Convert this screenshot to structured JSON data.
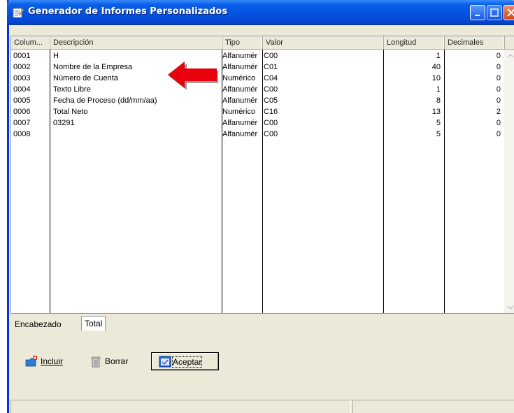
{
  "window": {
    "title": "Generador de Informes Personalizados"
  },
  "grid": {
    "headers": [
      "Colum...",
      "Descripción",
      "Tipo",
      "Valor",
      "Longitud",
      "Decimales"
    ],
    "rows": [
      {
        "col": "0001",
        "desc": "H",
        "tipo": "Alfanumér",
        "valor": "C00",
        "longitud": "1",
        "decimales": "0"
      },
      {
        "col": "0002",
        "desc": "Nombre de la Empresa",
        "tipo": "Alfanumér",
        "valor": "C01",
        "longitud": "40",
        "decimales": "0"
      },
      {
        "col": "0003",
        "desc": "Número de Cuenta",
        "tipo": "Numérico",
        "valor": "C04",
        "longitud": "10",
        "decimales": "0"
      },
      {
        "col": "0004",
        "desc": "Texto Libre",
        "tipo": "Alfanumér",
        "valor": "C00",
        "longitud": "1",
        "decimales": "0"
      },
      {
        "col": "0005",
        "desc": "Fecha de Proceso (dd/mm/aa)",
        "tipo": "Alfanumér",
        "valor": "C05",
        "longitud": "8",
        "decimales": "0"
      },
      {
        "col": "0006",
        "desc": "Total Neto",
        "tipo": "Numérico",
        "valor": "C16",
        "longitud": "13",
        "decimales": "2"
      },
      {
        "col": "0007",
        "desc": "03291",
        "tipo": "Alfanumér",
        "valor": "C00",
        "longitud": "5",
        "decimales": "0"
      },
      {
        "col": "0008",
        "desc": "",
        "tipo": "Alfanumér",
        "valor": "C00",
        "longitud": "5",
        "decimales": "0"
      }
    ]
  },
  "tabs": [
    {
      "label": "Encabezado",
      "active": true
    },
    {
      "label": "Total",
      "active": false
    }
  ],
  "buttons": {
    "incluir": {
      "label": "Incluir",
      "icon": "add-folder-icon"
    },
    "borrar": {
      "label": "Borrar",
      "icon": "trash-icon"
    },
    "aceptar": {
      "label": "Aceptar",
      "icon": "accept-window-icon"
    }
  },
  "annotation": {
    "icon": "red-arrow-pointer",
    "color": "#e8000e"
  },
  "colors": {
    "titlebar": "#0554e3",
    "window": "#ece9d8",
    "close": "#d2421a"
  }
}
